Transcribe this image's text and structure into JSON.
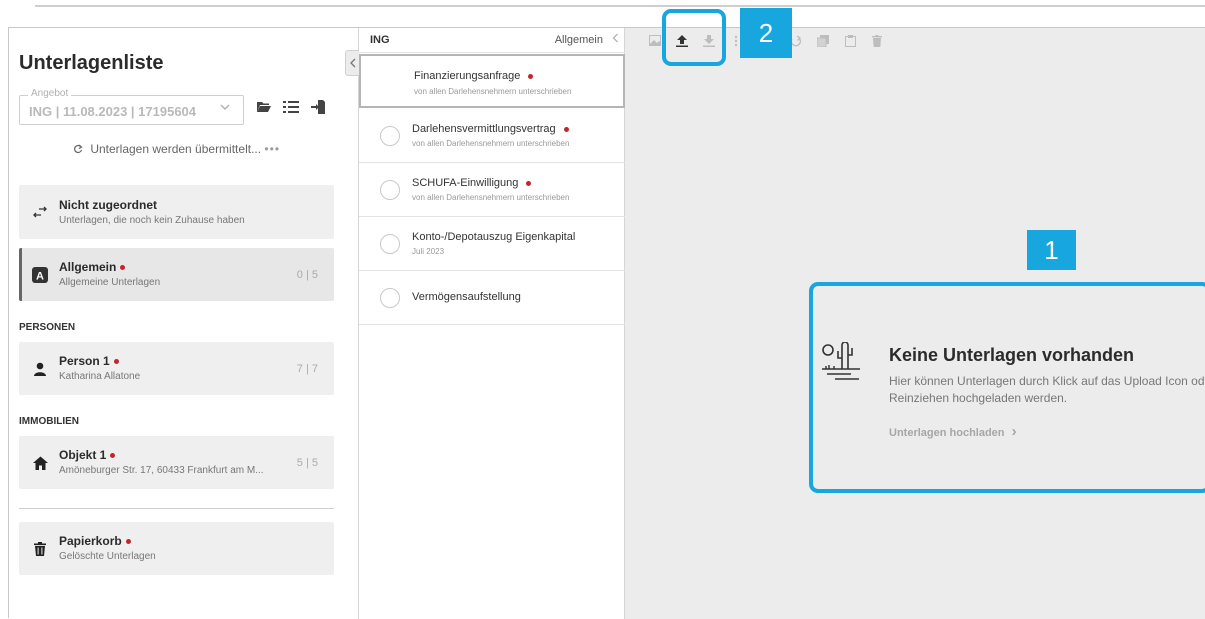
{
  "sidebar": {
    "title": "Unterlagenliste",
    "offer": {
      "legend": "Angebot",
      "value": "ING | 11.08.2023 | 17195604"
    },
    "status_text": "Unterlagen werden übermittelt...",
    "status_dots": "•••",
    "unassigned": {
      "title": "Nicht zugeordnet",
      "subtitle": "Unterlagen, die noch kein Zuhause haben"
    },
    "general": {
      "title": "Allgemein",
      "subtitle": "Allgemeine Unterlagen",
      "count": "0 | 5"
    },
    "persons_label": "PERSONEN",
    "person": {
      "title": "Person 1",
      "subtitle": "Katharina Allatone",
      "count": "7 | 7"
    },
    "properties_label": "IMMOBILIEN",
    "property": {
      "title": "Objekt 1",
      "subtitle": "Amöneburger Str. 17, 60433 Frankfurt am M...",
      "count": "5 | 5"
    },
    "trash": {
      "title": "Papierkorb",
      "subtitle": "Gelöschte Unterlagen"
    }
  },
  "doclist": {
    "bank": "ING",
    "category": "Allgemein",
    "items": [
      {
        "title": "Finanzierungsanfrage",
        "subtitle": "von allen Darlehensnehmern unterschrieben",
        "required": true
      },
      {
        "title": "Darlehensvermittlungsvertrag",
        "subtitle": "von allen Darlehensnehmern unterschrieben",
        "required": true
      },
      {
        "title": "SCHUFA-Einwilligung",
        "subtitle": "von allen Darlehensnehmern unterschrieben",
        "required": true
      },
      {
        "title": "Konto-/Depotauszug Eigenkapital",
        "subtitle": "Juli 2023",
        "required": false
      },
      {
        "title": "Vermögensaufstellung",
        "subtitle": "",
        "required": false
      }
    ]
  },
  "preview": {
    "empty_title": "Keine Unterlagen vorhanden",
    "empty_desc": "Hier können Unterlagen durch Klick auf das Upload Icon oder Reinziehen hochgeladen werden.",
    "upload_link": "Unterlagen hochladen",
    "link_chevron": "›"
  },
  "annotations": {
    "badge_1": "1",
    "badge_2": "2",
    "color": "#18a6df"
  },
  "colors": {
    "required_dot": "#c0272d",
    "accent": "#18a6df"
  }
}
